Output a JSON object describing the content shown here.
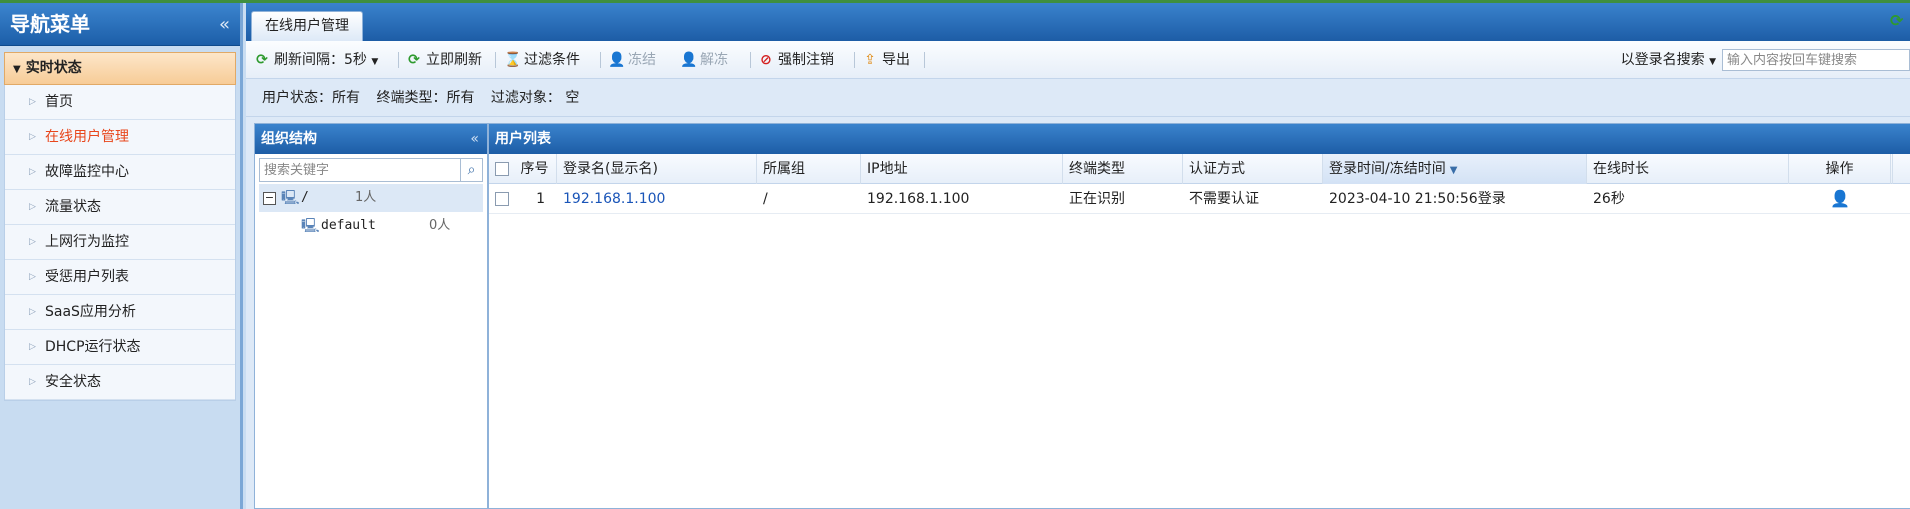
{
  "nav": {
    "title": "导航菜单",
    "collapse_icon": "«",
    "group": "实时状态",
    "items": [
      {
        "label": "首页",
        "active": false
      },
      {
        "label": "在线用户管理",
        "active": true
      },
      {
        "label": "故障监控中心",
        "active": false
      },
      {
        "label": "流量状态",
        "active": false
      },
      {
        "label": "上网行为监控",
        "active": false
      },
      {
        "label": "受惩用户列表",
        "active": false
      },
      {
        "label": "SaaS应用分析",
        "active": false
      },
      {
        "label": "DHCP运行状态",
        "active": false
      },
      {
        "label": "安全状态",
        "active": false
      }
    ]
  },
  "tab": {
    "label": "在线用户管理"
  },
  "toolbar": {
    "refresh_interval": "刷新间隔：5秒",
    "refresh_now": "立即刷新",
    "filter": "过滤条件",
    "freeze": "冻结",
    "unfreeze": "解冻",
    "force_logout": "强制注销",
    "export": "导出",
    "search_mode": "以登录名搜索",
    "search_placeholder": "输入内容按回车键搜索"
  },
  "filterbar": {
    "user_status": "用户状态：所有",
    "terminal_type": "终端类型：所有",
    "filter_target": "过滤对象： 空"
  },
  "org": {
    "title": "组织结构",
    "search_placeholder": "搜索关键字",
    "tree": [
      {
        "name": "/",
        "count": "1人"
      },
      {
        "name": "default",
        "count": "0人"
      }
    ]
  },
  "users": {
    "title": "用户列表",
    "columns": [
      "序号",
      "登录名(显示名)",
      "所属组",
      "IP地址",
      "终端类型",
      "认证方式",
      "登录时间/冻结时间",
      "在线时长",
      "操作"
    ],
    "rows": [
      {
        "index": "1",
        "login": "192.168.1.100",
        "group": "/",
        "ip": "192.168.1.100",
        "terminal": "正在识别",
        "auth": "不需要认证",
        "login_time": "2023-04-10 21:50:56登录",
        "duration": "26秒"
      }
    ]
  },
  "colors": {
    "header_blue": "#1d5da6",
    "active_nav": "#e8471c",
    "link": "#1a55b8"
  }
}
